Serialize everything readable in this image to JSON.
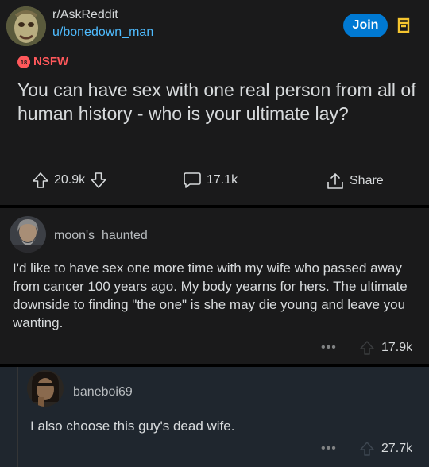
{
  "post": {
    "subreddit": "r/AskReddit",
    "author": "u/bonedown_man",
    "join_label": "Join",
    "nsfw_badge": "18",
    "nsfw_label": "NSFW",
    "title": "You can have sex with one real person from all of human history - who is your ultimate lay?",
    "upvotes": "20.9k",
    "comments": "17.1k",
    "share_label": "Share"
  },
  "comments": [
    {
      "username": "moon's_haunted",
      "body": "I'd like to have sex one more time with my wife who passed away from cancer 100 years ago.  My body yearns for hers.  The ultimate downside to finding \"the one\" is she may die young and leave you wanting.",
      "more": "•••",
      "votes": "17.9k"
    },
    {
      "username": "baneboi69",
      "body": "I also choose this guy's dead wife.",
      "more": "•••",
      "votes": "27.7k"
    }
  ],
  "colors": {
    "background": "#000000",
    "card": "#1a1a1b",
    "reply_card": "#1f262e",
    "accent": "#0079d3",
    "link": "#4fbcff",
    "nsfw": "#ff585b",
    "save": "#f5c52f"
  },
  "icons": [
    "avatar",
    "save-icon",
    "nsfw-icon",
    "upvote-icon",
    "downvote-icon",
    "comment-icon",
    "share-icon"
  ]
}
